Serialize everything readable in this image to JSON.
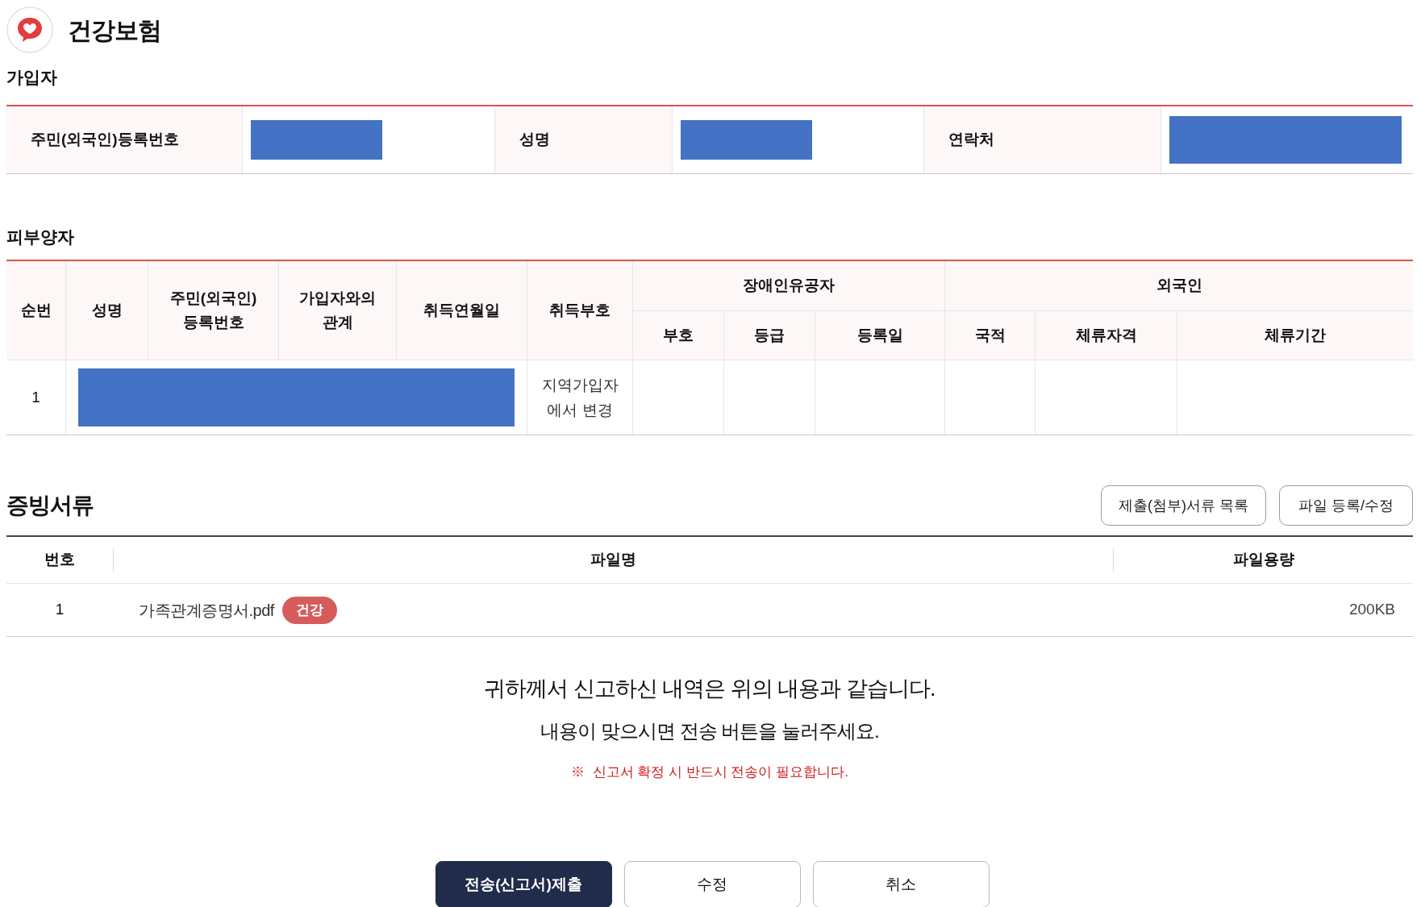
{
  "app": {
    "title": "건강보험"
  },
  "subscriber": {
    "heading": "가입자",
    "fields": [
      {
        "label": "주민(외국인)등록번호",
        "redacted": true
      },
      {
        "label": "성명",
        "redacted": true
      },
      {
        "label": "연락처",
        "redacted": true
      }
    ]
  },
  "dependents": {
    "heading": "피부양자",
    "columns": [
      {
        "label": "순번"
      },
      {
        "label": "성명"
      },
      {
        "label": "주민(외국인)\n등록번호"
      },
      {
        "label": "가입자와의\n관계"
      },
      {
        "label": "취득연월일"
      },
      {
        "label": "취득부호"
      }
    ],
    "groups": [
      {
        "label": "장애인유공자",
        "columns": [
          "부호",
          "등급",
          "등록일"
        ]
      },
      {
        "label": "외국인",
        "columns": [
          "국적",
          "체류자격",
          "체류기간"
        ]
      }
    ],
    "rows": [
      {
        "number": "1",
        "redacted": true,
        "acquisition_code": "지역가입자\n에서 변경"
      }
    ]
  },
  "documents": {
    "heading": "증빙서류",
    "buttons": [
      "제출(첨부)서류 목록",
      "파일 등록/수정"
    ],
    "columns": [
      "번호",
      "파일명",
      "파일용량"
    ],
    "rows": [
      {
        "number": "1",
        "file_name": "가족관계증명서.pdf",
        "tag": "건강",
        "size": "200KB"
      }
    ]
  },
  "notice": {
    "lines": [
      "귀하께서 신고하신 내역은 위의 내용과 같습니다.",
      "내용이 맞으시면 전송 버튼을 눌러주세요."
    ],
    "warning": "※  신고서 확정 시 반드시 전송이 필요합니다."
  },
  "actions": [
    {
      "label": "전송(신고서)제출",
      "kind": "primary"
    },
    {
      "label": "수정",
      "kind": "secondary"
    },
    {
      "label": "취소",
      "kind": "secondary"
    }
  ]
}
